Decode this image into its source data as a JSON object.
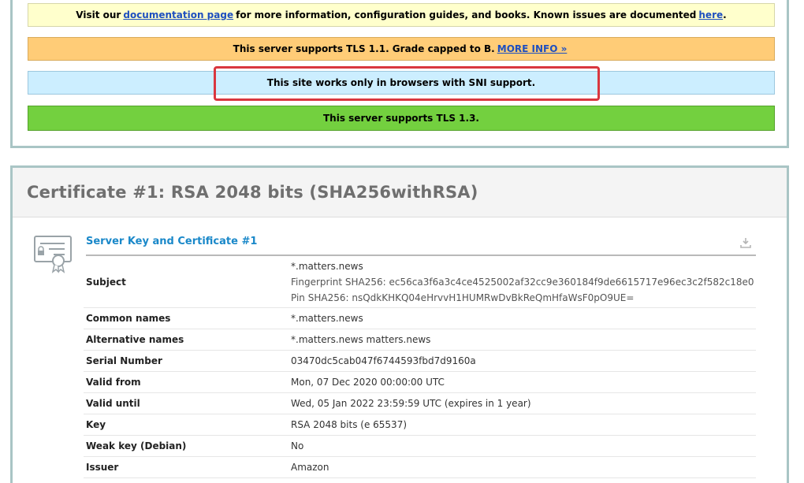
{
  "notices": {
    "doc": {
      "prefix": "Visit our",
      "link1": "documentation page",
      "middle": "for more information, configuration guides, and books. Known issues are documented",
      "link2": "here",
      "suffix": "."
    },
    "tls11": {
      "text": "This server supports TLS 1.1. Grade capped to B.",
      "link": "MORE INFO »"
    },
    "sni": {
      "text": "This site works only in browsers with SNI support."
    },
    "tls13": {
      "text": "This server supports TLS 1.3."
    }
  },
  "certificate": {
    "title": "Certificate #1: RSA 2048 bits (SHA256withRSA)",
    "section_title": "Server Key and Certificate #1",
    "icons": {
      "cert": "certificate-icon",
      "download": "download-icon"
    },
    "rows": [
      {
        "key": "Subject",
        "values": [
          "*.matters.news",
          "Fingerprint SHA256: ec56ca3f6a3c4ce4525002af32cc9e360184f9de6615717e96ec3c2f582c18e0",
          "Pin SHA256: nsQdkKHKQ04eHrvvH1HUMRwDvBkReQmHfaWsF0pO9UE="
        ]
      },
      {
        "key": "Common names",
        "values": [
          "*.matters.news"
        ]
      },
      {
        "key": "Alternative names",
        "values": [
          "*.matters.news matters.news"
        ]
      },
      {
        "key": "Serial Number",
        "values": [
          "03470dc5cab047f6744593fbd7d9160a"
        ]
      },
      {
        "key": "Valid from",
        "values": [
          "Mon, 07 Dec 2020 00:00:00 UTC"
        ]
      },
      {
        "key": "Valid until",
        "values": [
          "Wed, 05 Jan 2022 23:59:59 UTC (expires in 1 year)"
        ]
      },
      {
        "key": "Key",
        "values": [
          "RSA 2048 bits (e 65537)"
        ]
      },
      {
        "key": "Weak key (Debian)",
        "values": [
          "No"
        ]
      },
      {
        "key": "Issuer",
        "values": [
          "Amazon"
        ]
      }
    ]
  },
  "colors": {
    "link": "#1e4fbf",
    "section_title": "#1a88c9",
    "highlight": "#d9373f",
    "panel_border": "#a9c5c5"
  }
}
